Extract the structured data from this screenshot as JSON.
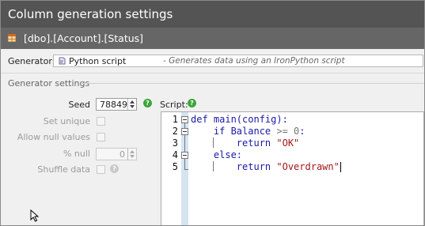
{
  "window": {
    "title": "Column generation settings"
  },
  "column": {
    "path": "[dbo].[Account].[Status]"
  },
  "generator": {
    "label": "Generator:",
    "name": "Python script",
    "description": "- Generates data using an IronPython script"
  },
  "settings": {
    "section_title": "Generator settings",
    "seed_label": "Seed",
    "seed_value": "78849",
    "set_unique_label": "Set unique",
    "allow_null_label": "Allow null values",
    "pct_null_label": "% null",
    "pct_null_value": "0",
    "shuffle_label": "Shuffle data"
  },
  "script": {
    "label": "Script:",
    "line_numbers": [
      "1",
      "2",
      "3",
      "4",
      "5"
    ],
    "lines": [
      {
        "parts": [
          {
            "t": "def main(config):",
            "c": "kw"
          }
        ]
      },
      {
        "parts": [
          {
            "t": "    if Balance ",
            "c": "kw"
          },
          {
            "t": ">= 0",
            "c": "num"
          },
          {
            "t": ":",
            "c": "kw"
          }
        ]
      },
      {
        "parts": [
          {
            "t": "        return ",
            "c": "kw"
          },
          {
            "t": "\"OK\"",
            "c": "str"
          }
        ]
      },
      {
        "parts": [
          {
            "t": "    else:",
            "c": "kw"
          }
        ]
      },
      {
        "parts": [
          {
            "t": "        return ",
            "c": "kw"
          },
          {
            "t": "\"Overdrawn\"",
            "c": "str"
          }
        ]
      }
    ]
  },
  "colors": {
    "titlebar": "#545454",
    "subbar": "#666666",
    "help": "#3aa63a",
    "keyword": "#1a1aa6",
    "string": "#a31515"
  },
  "icons": [
    "table-icon",
    "python-script-icon",
    "help-icon",
    "mouse-cursor-icon"
  ]
}
